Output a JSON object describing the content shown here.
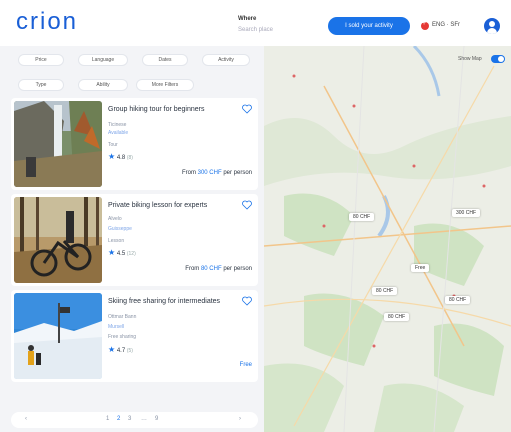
{
  "header": {
    "logo": "crion",
    "where_label": "Where",
    "where_placeholder": "Search place",
    "cta_label": "I sold your activity",
    "locale": "ENG · SFr",
    "accent": "#1a73e8"
  },
  "filters": [
    "Price",
    "Language",
    "Dates",
    "Activity",
    "Type",
    "Ability",
    "More Filters"
  ],
  "cards": [
    {
      "title": "Group hiking tour for beginners",
      "meta1": "Ticinese",
      "meta2": "Available",
      "meta3": "Tour",
      "rating": "4.8",
      "count": "(8)",
      "price_prefix": "From",
      "price_amount": "300 CHF",
      "price_suffix": "per person"
    },
    {
      "title": "Private biking lesson for experts",
      "meta1": "Alvelo",
      "meta2": "Guisseppe",
      "meta3": "Lesson",
      "rating": "4.5",
      "count": "(12)",
      "price_prefix": "From",
      "price_amount": "80 CHF",
      "price_suffix": "per person"
    },
    {
      "title": "Skiing free sharing for intermediates",
      "meta1": "Ottmar Bann",
      "meta2": "Mursell",
      "meta3": "Free sharing",
      "rating": "4.7",
      "count": "(5)",
      "free_label": "Free"
    }
  ],
  "pagination": {
    "prev": "‹",
    "pages": [
      "1",
      "2",
      "3",
      "…",
      "9"
    ],
    "next": "›"
  },
  "map": {
    "toggle_label": "Show Map",
    "pins": [
      "80 CHF",
      "300 CHF",
      "Free",
      "80 CHF",
      "80 CHF",
      "80 CHF"
    ]
  }
}
